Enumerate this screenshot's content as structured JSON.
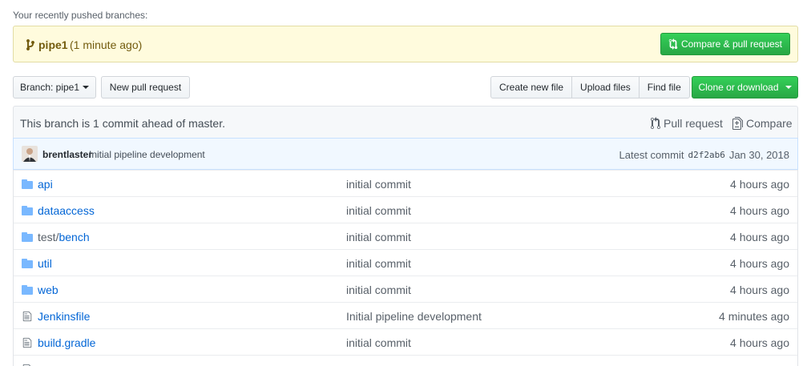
{
  "recent": {
    "label": "Your recently pushed branches:"
  },
  "pushed": {
    "branch": "pipe1",
    "time": "(1 minute ago)",
    "compare_label": "Compare & pull request"
  },
  "toolbar": {
    "branch_label": "Branch: pipe1",
    "new_pr": "New pull request",
    "create_file": "Create new file",
    "upload_files": "Upload files",
    "find_file": "Find file",
    "clone": "Clone or download"
  },
  "branch_info": {
    "status": "This branch is 1 commit ahead of master.",
    "pull_request": "Pull request",
    "compare": "Compare"
  },
  "commit": {
    "author": "brentlaster",
    "message": "Initial pipeline development",
    "latest_label": "Latest commit",
    "sha": "d2f2ab6",
    "date": "Jan 30, 2018"
  },
  "files": [
    {
      "type": "folder",
      "prefix": "",
      "name": "api",
      "message": "initial commit",
      "age": "4 hours ago"
    },
    {
      "type": "folder",
      "prefix": "",
      "name": "dataaccess",
      "message": "initial commit",
      "age": "4 hours ago"
    },
    {
      "type": "folder",
      "prefix": "test/",
      "name": "bench",
      "message": "initial commit",
      "age": "4 hours ago"
    },
    {
      "type": "folder",
      "prefix": "",
      "name": "util",
      "message": "initial commit",
      "age": "4 hours ago"
    },
    {
      "type": "folder",
      "prefix": "",
      "name": "web",
      "message": "initial commit",
      "age": "4 hours ago"
    },
    {
      "type": "file",
      "prefix": "",
      "name": "Jenkinsfile",
      "message": "Initial pipeline development",
      "age": "4 minutes ago"
    },
    {
      "type": "file",
      "prefix": "",
      "name": "build.gradle",
      "message": "initial commit",
      "age": "4 hours ago"
    },
    {
      "type": "file",
      "prefix": "",
      "name": "",
      "message": "",
      "age": ""
    }
  ],
  "colors": {
    "green": "#28a745",
    "link": "#0366d6",
    "banner": "#fffbdd",
    "folder": "#79b8ff"
  },
  "icons": {
    "branch": "git-branch-icon",
    "pr": "git-pull-request-icon",
    "compare": "diff-icon",
    "folder": "folder-icon",
    "file": "file-icon"
  }
}
